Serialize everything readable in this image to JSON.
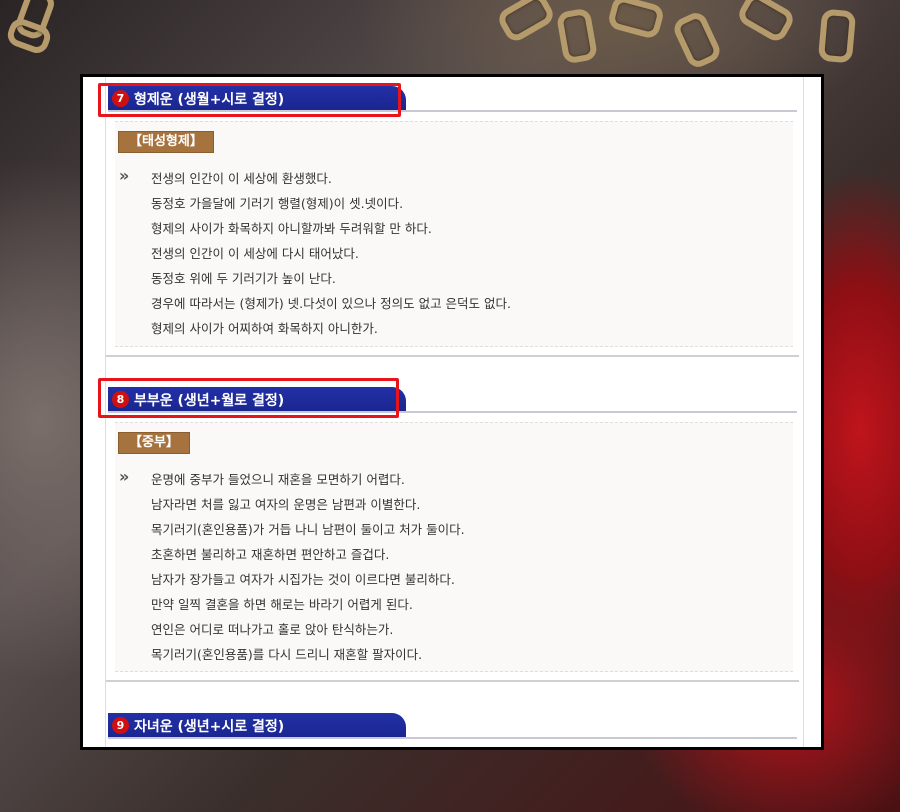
{
  "sections": [
    {
      "number": "7",
      "title": "형제운 (생월+시로 결정)",
      "badge": "【태성형제】",
      "lines": [
        "전생의 인간이 이 세상에 환생했다.",
        "동정호 가을달에 기러기 행렬(형제)이 셋.넷이다.",
        "형제의 사이가 화목하지 아니할까봐 두려워할 만 하다.",
        "전생의 인간이 이 세상에 다시 태어났다.",
        "동정호 위에 두 기러기가 높이 난다.",
        "경우에 따라서는 (형제가) 넷.다섯이 있으나 정의도 없고 은덕도 없다.",
        "형제의 사이가 어찌하여 화목하지 아니한가."
      ]
    },
    {
      "number": "8",
      "title": "부부운 (생년+월로 결정)",
      "badge": "【중부】",
      "lines": [
        "운명에 중부가 들었으니 재혼을 모면하기 어렵다.",
        "남자라면 처를 잃고 여자의 운명은 남편과 이별한다.",
        "목기러기(혼인용품)가 거듭 나니 남편이 둘이고 처가 둘이다.",
        "초혼하면 불리하고 재혼하면 편안하고 즐겁다.",
        "남자가 장가들고 여자가 시집가는 것이 이르다면 불리하다.",
        "만약 일찍 결혼을 하면 해로는 바라기 어렵게 된다.",
        "연인은 어디로 떠나가고 홀로 앉아 탄식하는가.",
        "목기러기(혼인용품)를 다시 드리니 재혼할 팔자이다."
      ]
    },
    {
      "number": "9",
      "title": "자녀운 (생년+시로 결정)"
    }
  ],
  "bullet_glyph": "»",
  "colors": {
    "tab": "#1a2690",
    "badge": "#a6733f",
    "highlight": "#e8141c",
    "number": "#d01010"
  }
}
